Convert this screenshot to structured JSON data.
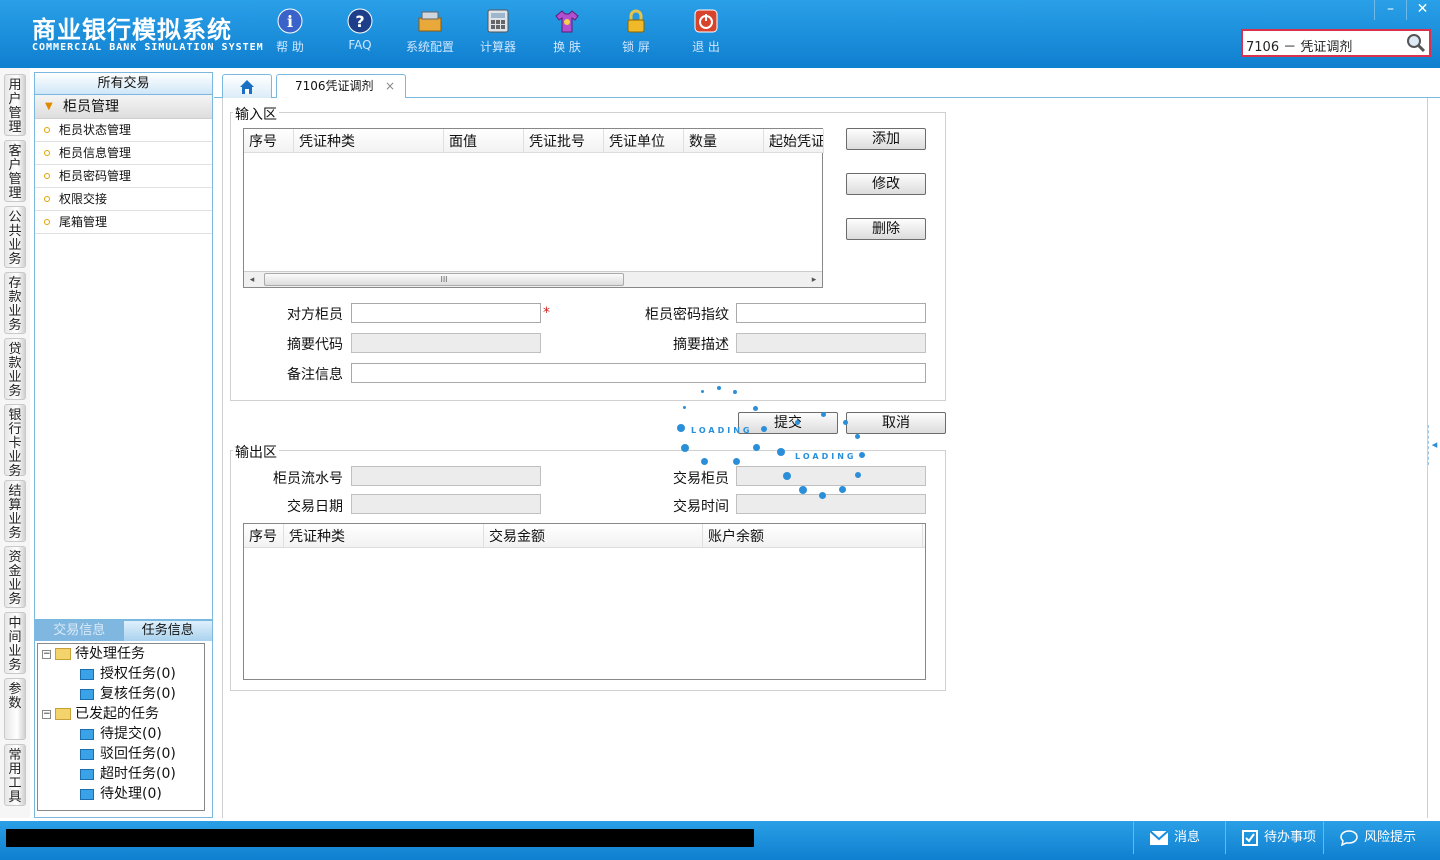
{
  "header": {
    "title": "商业银行模拟系统",
    "subtitle": "COMMERCIAL BANK SIMULATION SYSTEM",
    "toolbar": [
      {
        "label": "帮 助",
        "icon": "info-icon"
      },
      {
        "label": "FAQ",
        "icon": "question-icon"
      },
      {
        "label": "系统配置",
        "icon": "toolbox-icon"
      },
      {
        "label": "计算器",
        "icon": "calculator-icon"
      },
      {
        "label": "换 肤",
        "icon": "shirt-icon"
      },
      {
        "label": "锁 屏",
        "icon": "lock-icon"
      },
      {
        "label": "退 出",
        "icon": "power-icon"
      }
    ],
    "search_value": "7106 － 凭证调剂",
    "win_minimize": "–",
    "win_close": "✕"
  },
  "left_tabs": [
    "用户管理",
    "客户管理",
    "公共业务",
    "存款业务",
    "贷款业务",
    "银行卡业务",
    "结算业务",
    "资金业务",
    "中间业务",
    "参数",
    "常用工具"
  ],
  "nav": {
    "header": "所有交易",
    "group": "柜员管理",
    "items": [
      "柜员状态管理",
      "柜员信息管理",
      "柜员密码管理",
      "权限交接",
      "尾箱管理"
    ]
  },
  "task_panel": {
    "tabs": [
      "交易信息",
      "任务信息"
    ],
    "tree": {
      "pending": "待处理任务",
      "pending_children": [
        "授权任务(0)",
        "复核任务(0)"
      ],
      "initiated": "已发起的任务",
      "initiated_children": [
        "待提交(0)",
        "驳回任务(0)",
        "超时任务(0)",
        "待处理(0)"
      ]
    }
  },
  "tabs": {
    "home_icon": "home-icon",
    "active": "7106凭证调剂",
    "close": "×"
  },
  "input_area": {
    "legend": "输入区",
    "columns": [
      "序号",
      "凭证种类",
      "面值",
      "凭证批号",
      "凭证单位",
      "数量",
      "起始凭证"
    ],
    "scroll_grip": "III",
    "buttons": {
      "add": "添加",
      "modify": "修改",
      "delete": "删除"
    },
    "fields": {
      "counterpart_teller": "对方柜员",
      "teller_pwd_fp": "柜员密码指纹",
      "summary_code": "摘要代码",
      "summary_desc": "摘要描述",
      "remark": "备注信息"
    },
    "required_mark": "*"
  },
  "actions": {
    "submit": "提交",
    "cancel": "取消"
  },
  "loading_text": "LOADING",
  "output_area": {
    "legend": "输出区",
    "fields": {
      "teller_serial": "柜员流水号",
      "txn_teller": "交易柜员",
      "txn_date": "交易日期",
      "txn_time": "交易时间"
    },
    "columns": [
      "序号",
      "凭证种类",
      "交易金额",
      "账户余额"
    ]
  },
  "statusbar": {
    "message": "消息",
    "todo": "待办事项",
    "risk": "风险提示"
  },
  "colors": {
    "brand_blue": "#1a8ee0",
    "accent_red": "#d9324f"
  }
}
